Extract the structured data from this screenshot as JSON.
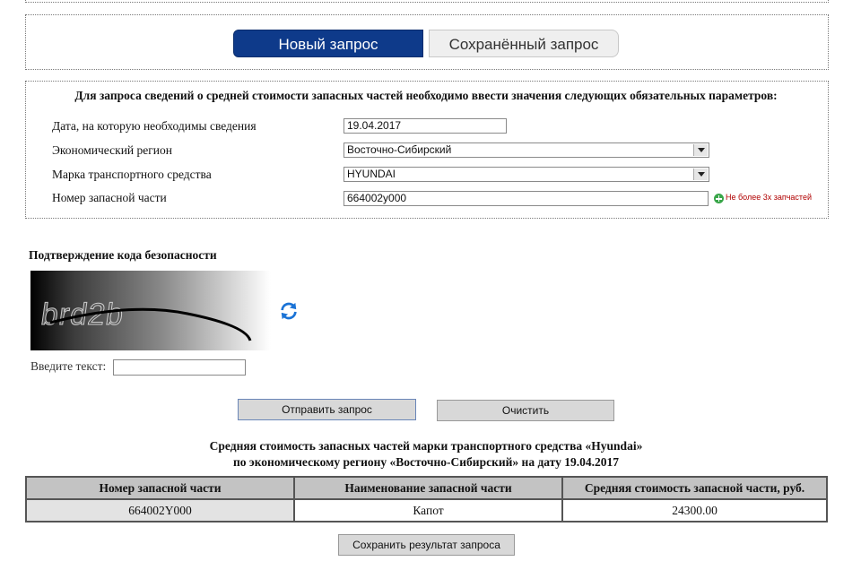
{
  "tabs": {
    "new_label": "Новый запрос",
    "saved_label": "Сохранённый запрос"
  },
  "params": {
    "title": "Для запроса сведений о средней стоимости запасных частей необходимо ввести значения следующих обязательных параметров:",
    "date_label": "Дата, на которую необходимы сведения",
    "date_value": "19.04.2017",
    "region_label": "Экономический регион",
    "region_value": "Восточно-Сибирский",
    "brand_label": "Марка транспортного средства",
    "brand_value": "HYUNDAI",
    "part_label": "Номер запасной части",
    "part_value": "664002y000",
    "part_note": "Не более 3х запчастей"
  },
  "captcha": {
    "title": "Подтверждение кода безопасности",
    "image_text": "brd2b",
    "enter_label": "Введите текст:",
    "input_value": ""
  },
  "buttons": {
    "send": "Отправить запрос",
    "clear": "Очистить",
    "save": "Сохранить результат запроса"
  },
  "result": {
    "title_line1": "Средняя стоимость запасных частей марки транспортного средства «Hyundai»",
    "title_line2": "по экономическому региону «Восточно-Сибирский» на дату 19.04.2017",
    "headers": [
      "Номер запасной части",
      "Наименование запасной части",
      "Средняя стоимость запасной части, руб."
    ],
    "rows": [
      [
        "664002Y000",
        "Капот",
        "24300.00"
      ]
    ]
  },
  "colors": {
    "tab_active": "#0e3a8a",
    "table_header": "#c3c3c3",
    "note_red": "#b00000",
    "plus_green": "#3aa64a",
    "refresh_blue": "#1a73d6"
  },
  "icons": {
    "refresh": "refresh-icon",
    "add": "plus-circle-icon"
  }
}
